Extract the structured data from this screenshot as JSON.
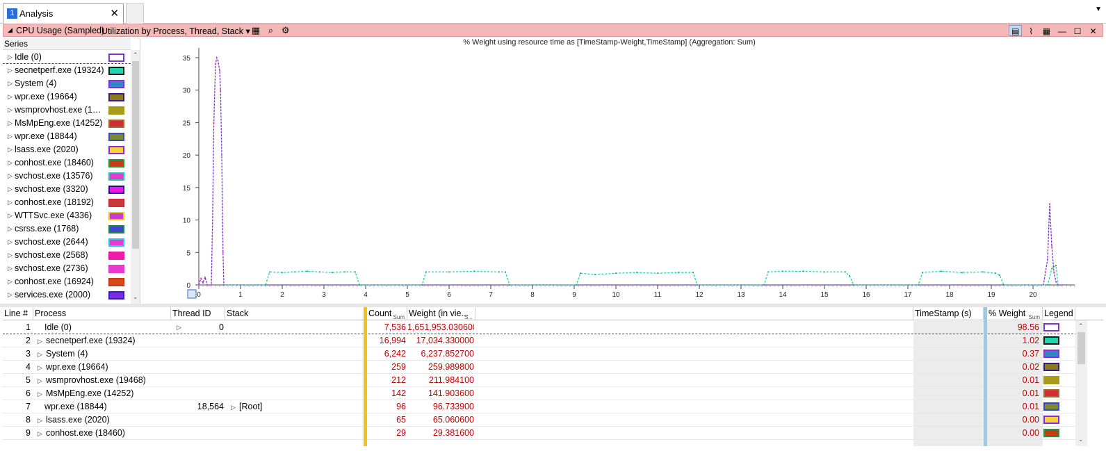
{
  "tabs": [
    {
      "number": "1",
      "label": "Analysis"
    }
  ],
  "graph_bar": {
    "title": "CPU Usage (Sampled)",
    "preset": "Utilization by Process, Thread, Stack ▾",
    "icons": [
      "chart-settings-icon",
      "search-icon",
      "gear-icon"
    ],
    "right_icons": [
      "graph-and-table-icon",
      "graph-only-icon",
      "table-only-icon",
      "minimize-icon",
      "maximize-icon",
      "close-icon"
    ]
  },
  "series_panel": {
    "header": "Series",
    "items": [
      {
        "label": "Idle (0)",
        "fill": "#ffffff",
        "border": "#7b35c9"
      },
      {
        "label": "secnetperf.exe (19324)",
        "fill": "#1fd6b3",
        "border": "#1a1a1a"
      },
      {
        "label": "System (4)",
        "fill": "#2f88c5",
        "border": "#8a2be2"
      },
      {
        "label": "wpr.exe (19664)",
        "fill": "#8a7a1c",
        "border": "#3a1a8a"
      },
      {
        "label": "wsmprovhost.exe (194...",
        "fill": "#a89a1c",
        "border": "#a89a1c"
      },
      {
        "label": "MsMpEng.exe (14252)",
        "fill": "#d42a3a",
        "border": "#a06a2a"
      },
      {
        "label": "wpr.exe (18844)",
        "fill": "#7a8a2a",
        "border": "#3a4ac9"
      },
      {
        "label": "lsass.exe (2020)",
        "fill": "#f5d23a",
        "border": "#8a2be2"
      },
      {
        "label": "conhost.exe (18460)",
        "fill": "#c83a1a",
        "border": "#1a9a3a"
      },
      {
        "label": "svchost.exe (13576)",
        "fill": "#e83ad0",
        "border": "#1acaa6"
      },
      {
        "label": "svchost.exe (3320)",
        "fill": "#e61ae0",
        "border": "#1a1a8a"
      },
      {
        "label": "conhost.exe (18192)",
        "fill": "#c83a3a",
        "border": "#d42a3a"
      },
      {
        "label": "WTTSvc.exe (4336)",
        "fill": "#c83ad0",
        "border": "#e8c81a"
      },
      {
        "label": "csrss.exe (1768)",
        "fill": "#3a4ac9",
        "border": "#1a8a3a"
      },
      {
        "label": "svchost.exe (2644)",
        "fill": "#e83ad0",
        "border": "#2acae0"
      },
      {
        "label": "svchost.exe (2568)",
        "fill": "#f01aa8",
        "border": "#f01aa8"
      },
      {
        "label": "svchost.exe (2736)",
        "fill": "#e83ad0",
        "border": "#e83ad0"
      },
      {
        "label": "conhost.exe (16924)",
        "fill": "#d4481a",
        "border": "#c83a1a"
      },
      {
        "label": "services.exe (2000)",
        "fill": "#7a2ae0",
        "border": "#3a1ac9"
      }
    ]
  },
  "chart_data": {
    "type": "line",
    "title": "% Weight using resource time as [TimeStamp-Weight,TimeStamp] (Aggregation: Sum)",
    "xlabel": "",
    "ylabel": "",
    "xlim": [
      0,
      21
    ],
    "ylim": [
      0,
      36.5
    ],
    "x_ticks": [
      "0",
      "1",
      "2",
      "3",
      "4",
      "5",
      "6",
      "7",
      "8",
      "9",
      "10",
      "11",
      "12",
      "13",
      "14",
      "15",
      "16",
      "17",
      "18",
      "19",
      "20"
    ],
    "y_ticks": [
      "0",
      "5",
      "10",
      "15",
      "20",
      "25",
      "30",
      "35"
    ],
    "grid": false,
    "series": [
      {
        "name": "Idle (0)",
        "color": "#7b35c9",
        "x": [
          0.0,
          0.05,
          0.1,
          0.15,
          0.2,
          0.25,
          0.3,
          0.33,
          0.36,
          0.4,
          0.43,
          0.46,
          0.5,
          0.52,
          0.55,
          0.58,
          0.6,
          20.25,
          20.3,
          20.35,
          20.4,
          20.45,
          20.5,
          20.55,
          20.6,
          20.7
        ],
        "y": [
          0,
          1.0,
          0.3,
          1.2,
          0,
          0,
          0,
          10,
          25,
          34,
          35,
          34.5,
          33,
          30,
          20,
          5,
          0,
          0,
          2,
          4,
          12.5,
          6,
          2,
          0.5,
          0,
          0
        ]
      },
      {
        "name": "secnetperf.exe (19324)",
        "color": "#1fd6b3",
        "x": [
          0.6,
          1.6,
          1.7,
          2.0,
          2.3,
          2.6,
          2.9,
          3.2,
          3.5,
          3.75,
          3.85,
          5.35,
          5.45,
          6.0,
          6.6,
          7.2,
          7.35,
          7.45,
          9.05,
          9.15,
          9.5,
          10.0,
          10.5,
          11.0,
          11.5,
          11.85,
          11.95,
          13.55,
          13.65,
          14.0,
          14.5,
          15.0,
          15.5,
          15.6,
          15.7,
          17.25,
          17.35,
          17.8,
          18.3,
          18.8,
          19.1,
          19.2,
          19.3,
          20.35,
          20.45,
          20.55,
          20.6
        ],
        "y": [
          0,
          0,
          2,
          1.9,
          2,
          2.1,
          2,
          1.9,
          2,
          2,
          0,
          0,
          2,
          2,
          2.1,
          2,
          2,
          0,
          0,
          1.8,
          1.6,
          1.8,
          1.9,
          1.8,
          1.9,
          1.9,
          0,
          0,
          2,
          2.1,
          2.1,
          2,
          2,
          1.4,
          0,
          0,
          1.9,
          2.1,
          1.9,
          2,
          1.8,
          1.5,
          0,
          0,
          2.5,
          3,
          0
        ]
      }
    ]
  },
  "table": {
    "columns": [
      "Line #",
      "Process",
      "Thread ID",
      "Stack",
      "Count",
      "Weight (in vie...",
      "TimeStamp (s)",
      "% Weight",
      "Legend"
    ],
    "count_sum_label": "Sum",
    "weight_sum_label": "S...",
    "pct_sum_label": "Sum",
    "rows": [
      {
        "line": "1",
        "process": "Idle (0)",
        "thread_id": "0",
        "stack": "",
        "count": "7,536",
        "weight": "1,651,953.030600",
        "pct": "98.56",
        "fill": "#ffffff",
        "border": "#7b35c9",
        "expand_process": false,
        "expand_thread": true
      },
      {
        "line": "2",
        "process": "secnetperf.exe (19324)",
        "thread_id": "",
        "stack": "",
        "count": "16,994",
        "weight": "17,034.330000",
        "pct": "1.02",
        "fill": "#1fd6b3",
        "border": "#1a1a1a",
        "expand_process": true,
        "expand_thread": false
      },
      {
        "line": "3",
        "process": "System (4)",
        "thread_id": "",
        "stack": "",
        "count": "6,242",
        "weight": "6,237.852700",
        "pct": "0.37",
        "fill": "#2f88c5",
        "border": "#8a2be2",
        "expand_process": true,
        "expand_thread": false
      },
      {
        "line": "4",
        "process": "wpr.exe (19664)",
        "thread_id": "",
        "stack": "",
        "count": "259",
        "weight": "259.989800",
        "pct": "0.02",
        "fill": "#8a7a1c",
        "border": "#3a1a8a",
        "expand_process": true,
        "expand_thread": false
      },
      {
        "line": "5",
        "process": "wsmprovhost.exe (19468)",
        "thread_id": "",
        "stack": "",
        "count": "212",
        "weight": "211.984100",
        "pct": "0.01",
        "fill": "#a89a1c",
        "border": "#a89a1c",
        "expand_process": true,
        "expand_thread": false
      },
      {
        "line": "6",
        "process": "MsMpEng.exe (14252)",
        "thread_id": "",
        "stack": "",
        "count": "142",
        "weight": "141.903600",
        "pct": "0.01",
        "fill": "#d42a3a",
        "border": "#a06a2a",
        "expand_process": true,
        "expand_thread": false
      },
      {
        "line": "7",
        "process": "wpr.exe (18844)",
        "thread_id": "18,564",
        "stack": "[Root]",
        "count": "96",
        "weight": "96.733900",
        "pct": "0.01",
        "fill": "#7a8a2a",
        "border": "#3a4ac9",
        "expand_process": false,
        "expand_thread": false
      },
      {
        "line": "8",
        "process": "lsass.exe (2020)",
        "thread_id": "",
        "stack": "",
        "count": "65",
        "weight": "65.060600",
        "pct": "0.00",
        "fill": "#f5d23a",
        "border": "#8a2be2",
        "expand_process": true,
        "expand_thread": false
      },
      {
        "line": "9",
        "process": "conhost.exe (18460)",
        "thread_id": "",
        "stack": "",
        "count": "29",
        "weight": "29.381600",
        "pct": "0.00",
        "fill": "#c83a1a",
        "border": "#1a9a3a",
        "expand_process": true,
        "expand_thread": false
      }
    ]
  }
}
